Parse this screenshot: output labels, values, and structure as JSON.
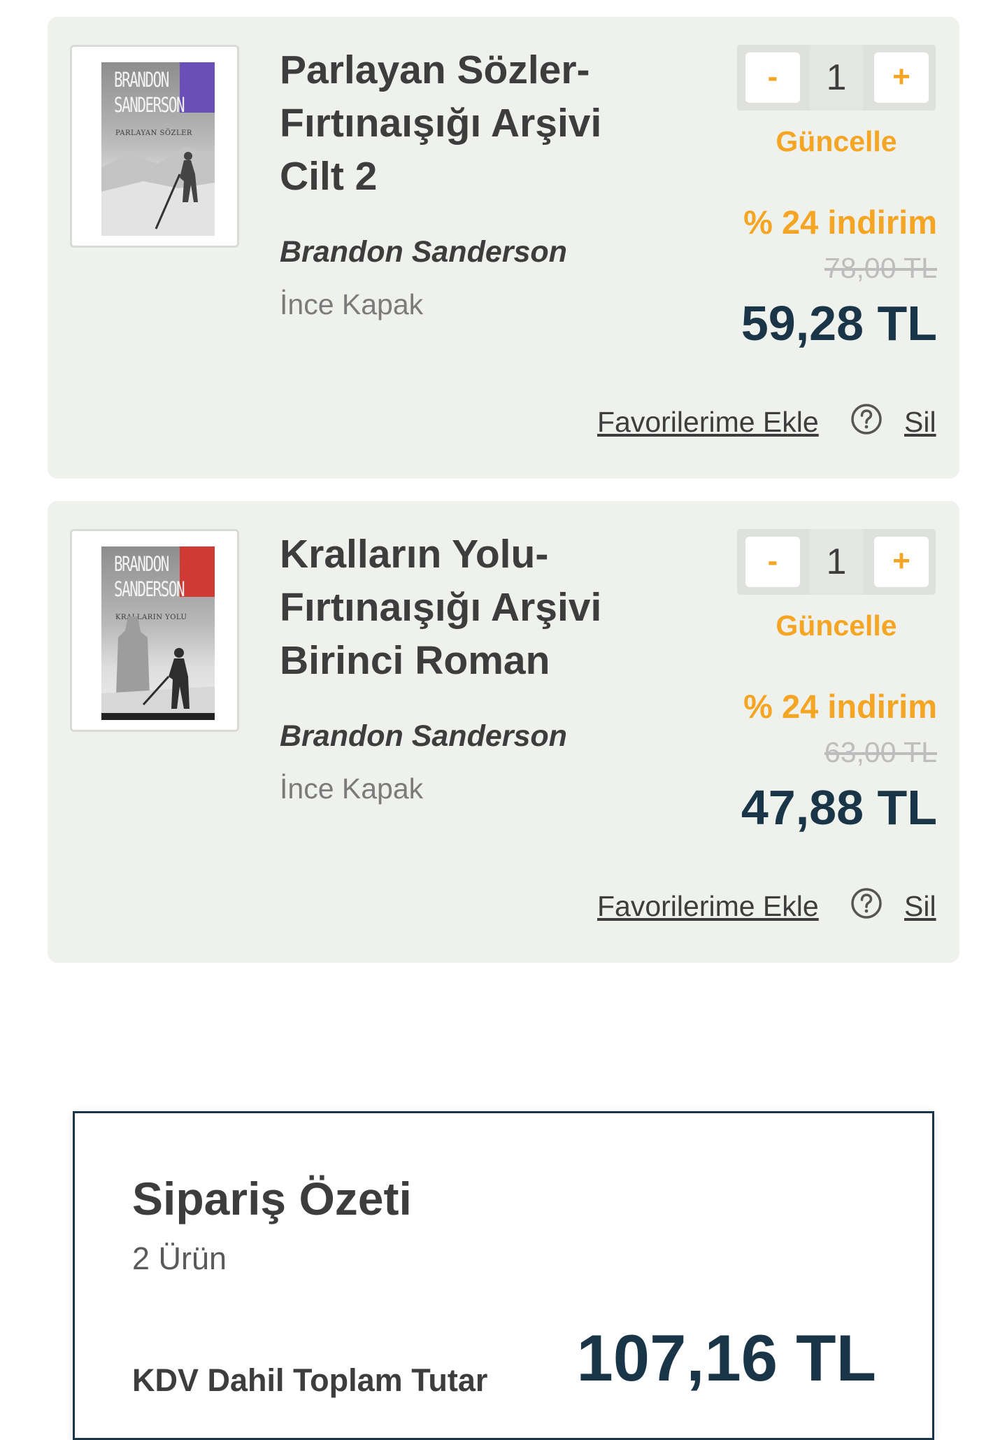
{
  "cart_items": [
    {
      "title": "Parlayan Sözler- Fırtınaışığı Arşivi Cilt 2",
      "author": "Brandon Sanderson",
      "binding": "İnce Kapak",
      "quantity": "1",
      "minus_label": "-",
      "plus_label": "+",
      "update_label": "Güncelle",
      "discount": "% 24 indirim",
      "old_price": "78,00 TL",
      "price": "59,28 TL",
      "favorite_label": "Favorilerime Ekle",
      "delete_label": "Sil",
      "cover": {
        "author_line1": "BRANDON",
        "author_line2": "SANDERSON",
        "title": "PARLAYAN SÖZLER",
        "accent_color": "#6b4fb8"
      }
    },
    {
      "title": "Kralların Yolu- Fırtınaışığı Arşivi Birinci Roman",
      "author": "Brandon Sanderson",
      "binding": "İnce Kapak",
      "quantity": "1",
      "minus_label": "-",
      "plus_label": "+",
      "update_label": "Güncelle",
      "discount": "% 24 indirim",
      "old_price": "63,00 TL",
      "price": "47,88 TL",
      "favorite_label": "Favorilerime Ekle",
      "delete_label": "Sil",
      "cover": {
        "author_line1": "BRANDON",
        "author_line2": "SANDERSON",
        "title": "KRALLARIN YOLU",
        "accent_color": "#d03a35"
      }
    }
  ],
  "summary": {
    "title": "Sipariş Özeti",
    "item_count": "2 Ürün",
    "total_label": "KDV Dahil Toplam Tutar",
    "total": "107,16 TL"
  },
  "icons": {
    "help": "question-circle-icon"
  },
  "colors": {
    "accent": "#f4a523",
    "price": "#1a3548",
    "card_bg": "#eff1ec"
  }
}
